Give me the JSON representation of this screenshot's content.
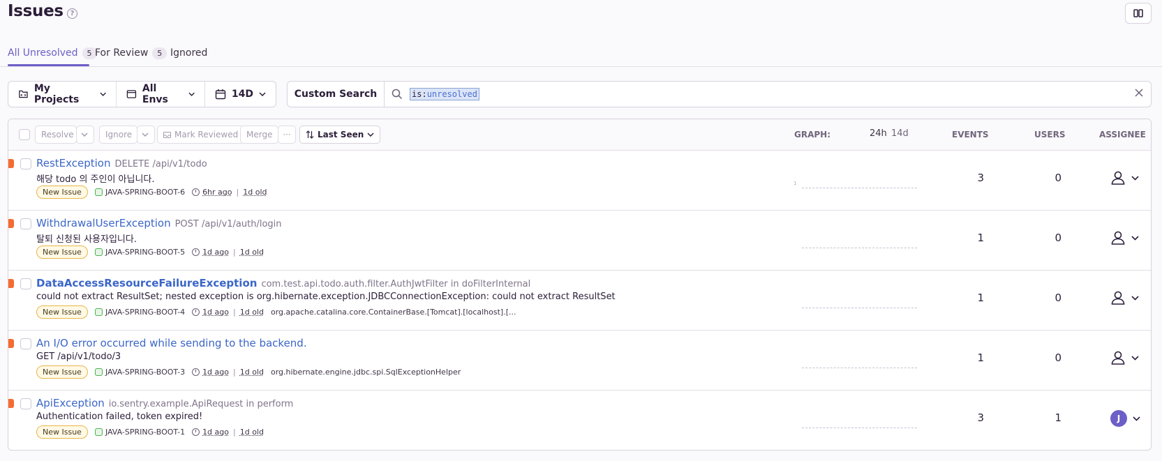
{
  "header": {
    "title": "Issues",
    "help_glyph": "?"
  },
  "tabs": [
    {
      "label": "All Unresolved",
      "count": "5"
    },
    {
      "label": "For Review",
      "count": "5"
    },
    {
      "label": "Ignored"
    }
  ],
  "filters": {
    "projects": "My Projects",
    "envs": "All Envs",
    "period": "14D"
  },
  "search": {
    "custom_label": "Custom Search",
    "token_key": "is:",
    "token_value": "unresolved"
  },
  "toolbar": {
    "resolve": "Resolve",
    "ignore": "Ignore",
    "mark_reviewed": "Mark Reviewed",
    "merge": "Merge",
    "more": "···",
    "sort": "Last Seen"
  },
  "columns": {
    "graph": "GRAPH:",
    "period_24h": "24h",
    "period_14d": "14d",
    "events": "EVENTS",
    "users": "USERS",
    "assignee": "ASSIGNEE"
  },
  "issues": [
    {
      "title": "RestException",
      "culprit": "DELETE /api/v1/todo",
      "message": "해당 todo 의 주인이 아닙니다.",
      "badge": "New Issue",
      "project": "JAVA-SPRING-BOOT-6",
      "last_seen": "6hr ago",
      "age": "1d old",
      "extra": "",
      "events": "3",
      "users": "0",
      "graph_label": "1",
      "assignee": ""
    },
    {
      "title": "WithdrawalUserException",
      "culprit": "POST /api/v1/auth/login",
      "message": "탈퇴 신청된 사용자입니다.",
      "badge": "New Issue",
      "project": "JAVA-SPRING-BOOT-5",
      "last_seen": "1d ago",
      "age": "1d old",
      "extra": "",
      "events": "1",
      "users": "0",
      "graph_label": "",
      "assignee": ""
    },
    {
      "title": "DataAccessResourceFailureException",
      "culprit": "com.test.api.todo.auth.filter.AuthJwtFilter in doFilterInternal",
      "message": "could not extract ResultSet; nested exception is org.hibernate.exception.JDBCConnectionException: could not extract ResultSet",
      "badge": "New Issue",
      "project": "JAVA-SPRING-BOOT-4",
      "last_seen": "1d ago",
      "age": "1d old",
      "extra": "org.apache.catalina.core.ContainerBase.[Tomcat].[localhost].[...",
      "events": "1",
      "users": "0",
      "graph_label": "",
      "assignee": ""
    },
    {
      "title": "An I/O error occurred while sending to the backend.",
      "culprit": "",
      "message": "GET /api/v1/todo/3",
      "badge": "New Issue",
      "project": "JAVA-SPRING-BOOT-3",
      "last_seen": "1d ago",
      "age": "1d old",
      "extra": "org.hibernate.engine.jdbc.spi.SqlExceptionHelper",
      "events": "1",
      "users": "0",
      "graph_label": "",
      "assignee": ""
    },
    {
      "title": "ApiException",
      "culprit": "io.sentry.example.ApiRequest in perform",
      "message": "Authentication failed, token expired!",
      "badge": "New Issue",
      "project": "JAVA-SPRING-BOOT-1",
      "last_seen": "1d ago",
      "age": "1d old",
      "extra": "",
      "events": "3",
      "users": "1",
      "graph_label": "",
      "assignee": "J"
    }
  ],
  "colors": {
    "accent": "#6c5fc7",
    "link": "#3b66c8",
    "level_error": "#f56c32"
  }
}
